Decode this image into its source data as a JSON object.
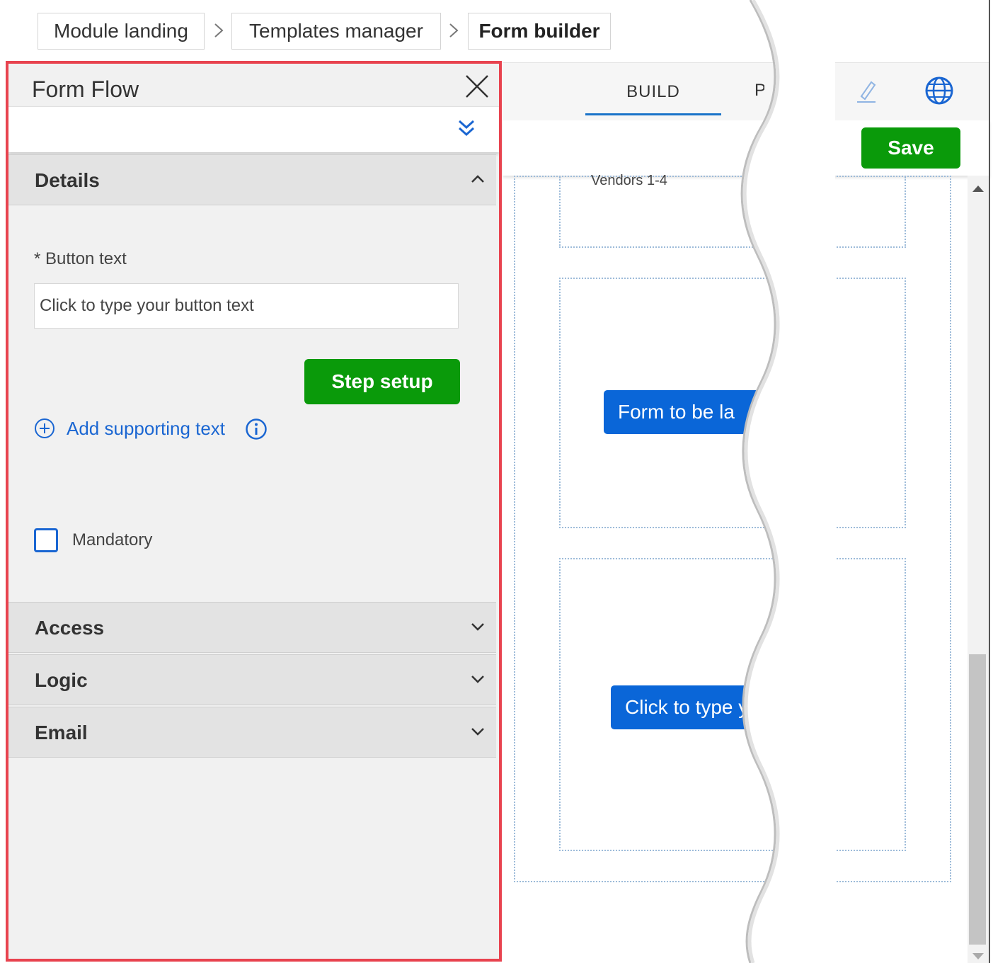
{
  "breadcrumb": {
    "items": [
      "Module landing",
      "Templates manager",
      "Form builder"
    ]
  },
  "builder": {
    "tab_build": "BUILD",
    "tab_partial": "P",
    "save_label": "Save",
    "slot_caption": "Vendors 1-4",
    "form_button_1": "Form to be la",
    "form_button_2": "Click to type y"
  },
  "panel": {
    "title": "Form Flow",
    "sections": {
      "details": "Details",
      "access": "Access",
      "logic": "Logic",
      "email": "Email"
    },
    "button_text_label": "* Button text",
    "button_text_placeholder": "Click to type your button text",
    "step_setup_label": "Step setup",
    "add_supporting_text": "Add supporting text",
    "mandatory_label": "Mandatory"
  },
  "colors": {
    "panel_outline": "#e8434f",
    "primary_green": "#0a9a0a",
    "link_blue": "#1a66d2",
    "form_button_blue": "#0a66d8"
  },
  "icons": {
    "close": "close-icon",
    "expand": "double-chevron-down-icon",
    "collapse": "chevron-up-icon",
    "expand_section": "chevron-down-icon",
    "add": "plus-circle-icon",
    "info": "info-icon",
    "edit": "pencil-icon",
    "language": "globe-icon",
    "crumb_separator": "chevron-right-icon"
  }
}
